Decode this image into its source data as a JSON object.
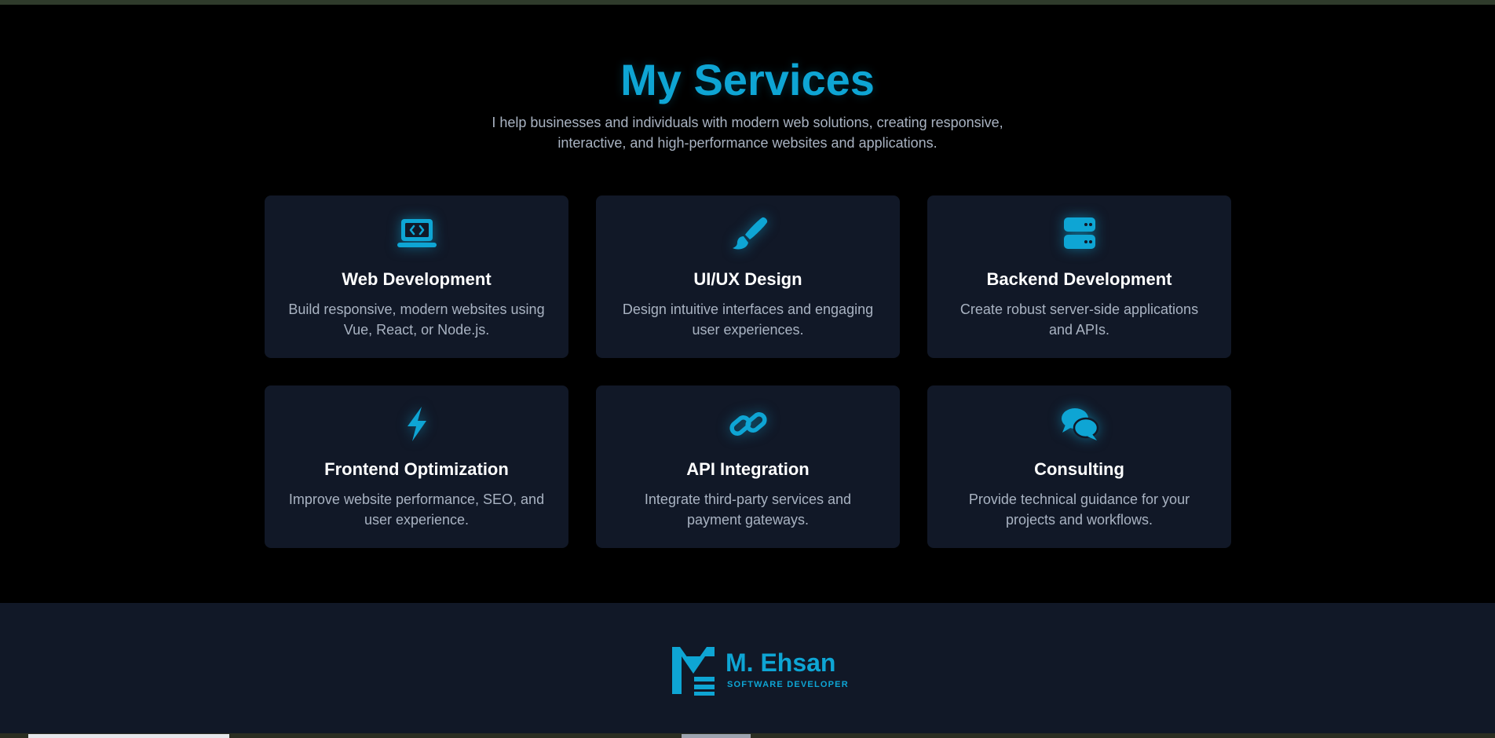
{
  "services": {
    "title": "My Services",
    "subtitle": "I help businesses and individuals with modern web solutions, creating responsive, interactive, and high-performance websites and applications.",
    "cards": [
      {
        "icon": "laptop-code-icon",
        "title": "Web Development",
        "desc": "Build responsive, modern websites using Vue, React, or Node.js."
      },
      {
        "icon": "paintbrush-icon",
        "title": "UI/UX Design",
        "desc": "Design intuitive interfaces and engaging user experiences."
      },
      {
        "icon": "server-icon",
        "title": "Backend Development",
        "desc": "Create robust server-side applications and APIs."
      },
      {
        "icon": "lightning-bolt-icon",
        "title": "Frontend Optimization",
        "desc": "Improve website performance, SEO, and user experience."
      },
      {
        "icon": "link-icon",
        "title": "API Integration",
        "desc": "Integrate third-party services and payment gateways."
      },
      {
        "icon": "chat-bubbles-icon",
        "title": "Consulting",
        "desc": "Provide technical guidance for your projects and workflows."
      }
    ]
  },
  "footer": {
    "logo_name": "M. Ehsan",
    "logo_tagline": "SOFTWARE DEVELOPER"
  },
  "colors": {
    "accent": "#0ea5d4",
    "card_bg": "#111827",
    "page_bg": "#000000",
    "text_muted": "#a9b3c2"
  }
}
